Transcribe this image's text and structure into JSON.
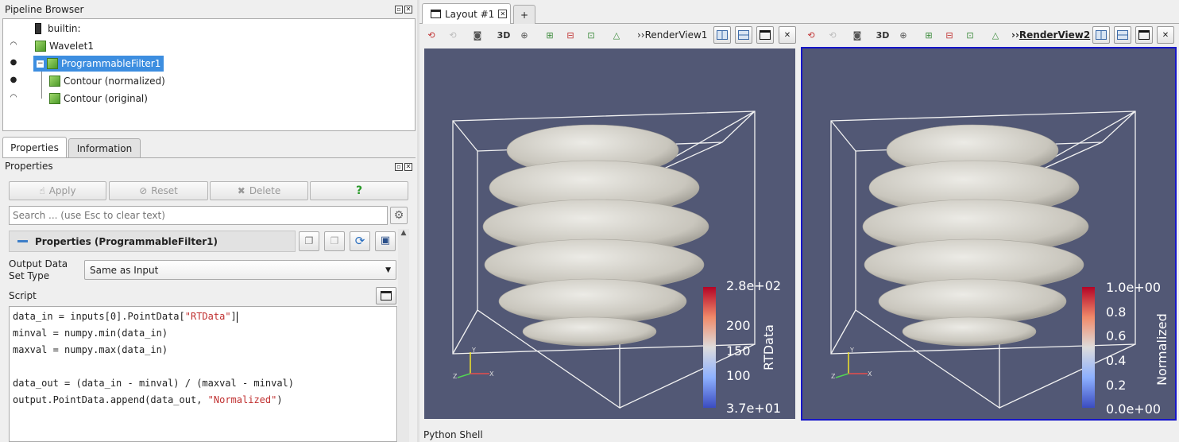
{
  "pipeline": {
    "title": "Pipeline Browser",
    "items": [
      {
        "label": "builtin:"
      },
      {
        "label": "Wavelet1"
      },
      {
        "label": "ProgrammableFilter1"
      },
      {
        "label": "Contour (normalized)"
      },
      {
        "label": "Contour (original)"
      }
    ]
  },
  "tabs": {
    "properties": "Properties",
    "information": "Information"
  },
  "properties": {
    "title": "Properties",
    "apply": "Apply",
    "reset": "Reset",
    "delete": "Delete",
    "help": "?",
    "search_placeholder": "Search ... (use Esc to clear text)",
    "section_title": "Properties (ProgrammableFilter1)",
    "output_type_label": "Output Data Set Type",
    "output_type_value": "Same as Input",
    "script_label": "Script"
  },
  "script": {
    "line1_a": "data_in = inputs[0].PointData[",
    "line1_str": "\"RTData\"",
    "line1_b": "]",
    "line2": "minval = numpy.min(data_in)",
    "line3": "maxval = numpy.max(data_in)",
    "line4": "",
    "line5": "data_out = (data_in - minval) / (maxval - minval)",
    "line6_a": "output.PointData.append(data_out, ",
    "line6_str": "\"Normalized\"",
    "line6_b": ")"
  },
  "layout": {
    "tab_label": "Layout #1",
    "add_tab": "+",
    "threeD": "3D"
  },
  "views": [
    {
      "name": "RenderView1",
      "colorbar_title": "RTData",
      "ticks": [
        "2.8e+02",
        "200",
        "150",
        "100",
        "3.7e+01"
      ]
    },
    {
      "name": "RenderView2",
      "colorbar_title": "Normalized",
      "ticks": [
        "1.0e+00",
        "0.8",
        "0.6",
        "0.4",
        "0.2",
        "0.0e+00"
      ]
    }
  ],
  "python_shell": {
    "title": "Python Shell"
  },
  "colors": {
    "view_bg": "#525875",
    "active_border": "#1616c8",
    "selection": "#3d8ee0"
  }
}
